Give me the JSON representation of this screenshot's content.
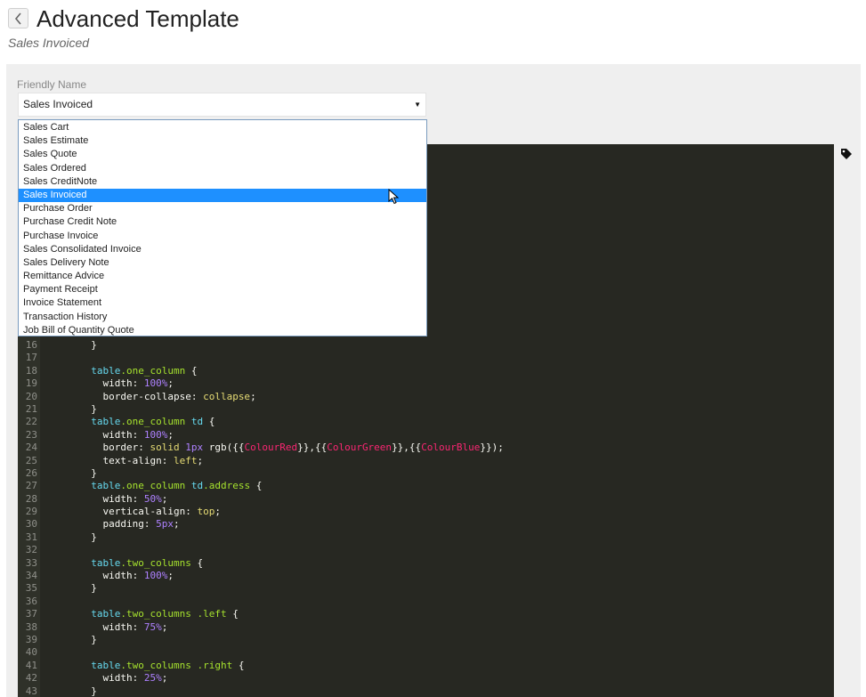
{
  "header": {
    "title": "Advanced Template",
    "subtitle": "Sales Invoiced"
  },
  "form": {
    "friendly_name_label": "Friendly Name",
    "friendly_name_value": "Sales Invoiced",
    "options": [
      "Sales Cart",
      "Sales Estimate",
      "Sales Quote",
      "Sales Ordered",
      "Sales CreditNote",
      "Sales Invoiced",
      "Purchase Order",
      "Purchase Credit Note",
      "Purchase Invoice",
      "Sales Consolidated Invoice",
      "Sales Delivery Note",
      "Remittance Advice",
      "Payment Receipt",
      "Invoice Statement",
      "Transaction History",
      "Job Bill of Quantity Quote"
    ],
    "selected_option": "Sales Invoiced"
  },
  "editor": {
    "lines": [
      {
        "n": "16",
        "t": "  }"
      },
      {
        "n": "17",
        "t": ""
      },
      {
        "n": "18",
        "t": "  table.one_column {"
      },
      {
        "n": "19",
        "t": "    width: 100%;"
      },
      {
        "n": "20",
        "t": "    border-collapse: collapse;"
      },
      {
        "n": "21",
        "t": "  }"
      },
      {
        "n": "22",
        "t": "  table.one_column td {"
      },
      {
        "n": "23",
        "t": "    width: 100%;"
      },
      {
        "n": "24",
        "t": "    border: solid 1px rgb({{ColourRed}},{{ColourGreen}},{{ColourBlue}});"
      },
      {
        "n": "25",
        "t": "    text-align: left;"
      },
      {
        "n": "26",
        "t": "  }"
      },
      {
        "n": "27",
        "t": "  table.one_column td.address {"
      },
      {
        "n": "28",
        "t": "    width: 50%;"
      },
      {
        "n": "29",
        "t": "    vertical-align: top;"
      },
      {
        "n": "30",
        "t": "    padding: 5px;"
      },
      {
        "n": "31",
        "t": "  }"
      },
      {
        "n": "32",
        "t": ""
      },
      {
        "n": "33",
        "t": "  table.two_columns {"
      },
      {
        "n": "34",
        "t": "    width: 100%;"
      },
      {
        "n": "35",
        "t": "  }"
      },
      {
        "n": "36",
        "t": ""
      },
      {
        "n": "37",
        "t": "  table.two_columns .left {"
      },
      {
        "n": "38",
        "t": "    width: 75%;"
      },
      {
        "n": "39",
        "t": "  }"
      },
      {
        "n": "40",
        "t": ""
      },
      {
        "n": "41",
        "t": "  table.two_columns .right {"
      },
      {
        "n": "42",
        "t": "    width: 25%;"
      },
      {
        "n": "43",
        "t": "  }"
      }
    ]
  },
  "icons": {
    "back": "chevron-left-icon",
    "tag": "tag-icon",
    "dropdown": "caret-down-icon"
  },
  "colors": {
    "selection": "#1e90ff",
    "editor_bg": "#272822",
    "panel_bg": "#efefef"
  }
}
